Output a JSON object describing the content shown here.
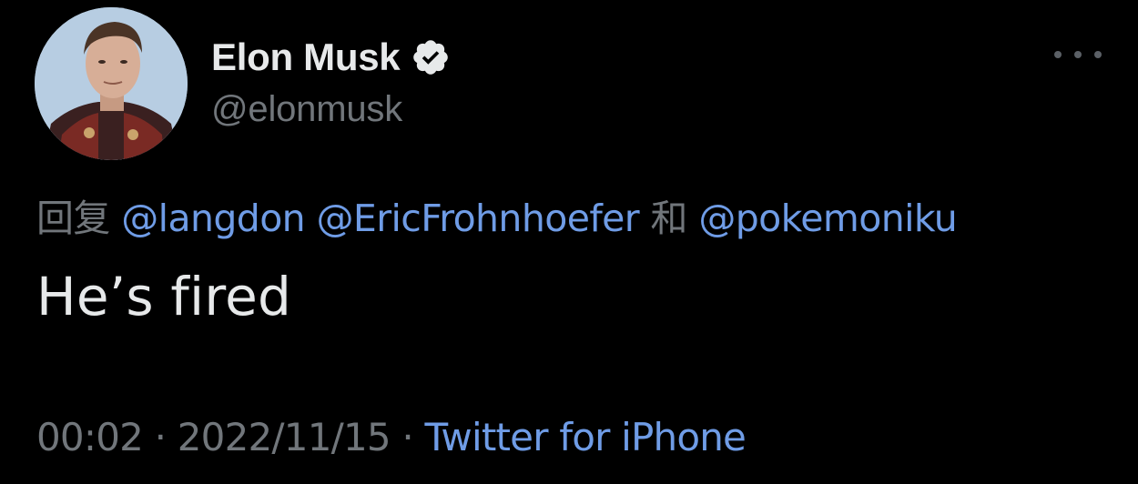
{
  "author": {
    "display_name": "Elon Musk",
    "handle": "@elonmusk",
    "verified_icon": "verified-badge-icon"
  },
  "reply": {
    "prefix": "回复",
    "mention_1": "@langdon",
    "mention_2": "@EricFrohnhoefer",
    "conjunction": "和",
    "mention_3": "@pokemoniku"
  },
  "tweet": {
    "text": "He’s fired"
  },
  "meta": {
    "time": "00:02",
    "separator": "·",
    "date": "2022/11/15",
    "source": "Twitter for iPhone"
  },
  "colors": {
    "background": "#000000",
    "primary_text": "#e7e9ea",
    "secondary_text": "#71767b",
    "link": "#6f9ce6"
  },
  "icons": {
    "more": "more-options-icon",
    "avatar": "profile-avatar"
  }
}
